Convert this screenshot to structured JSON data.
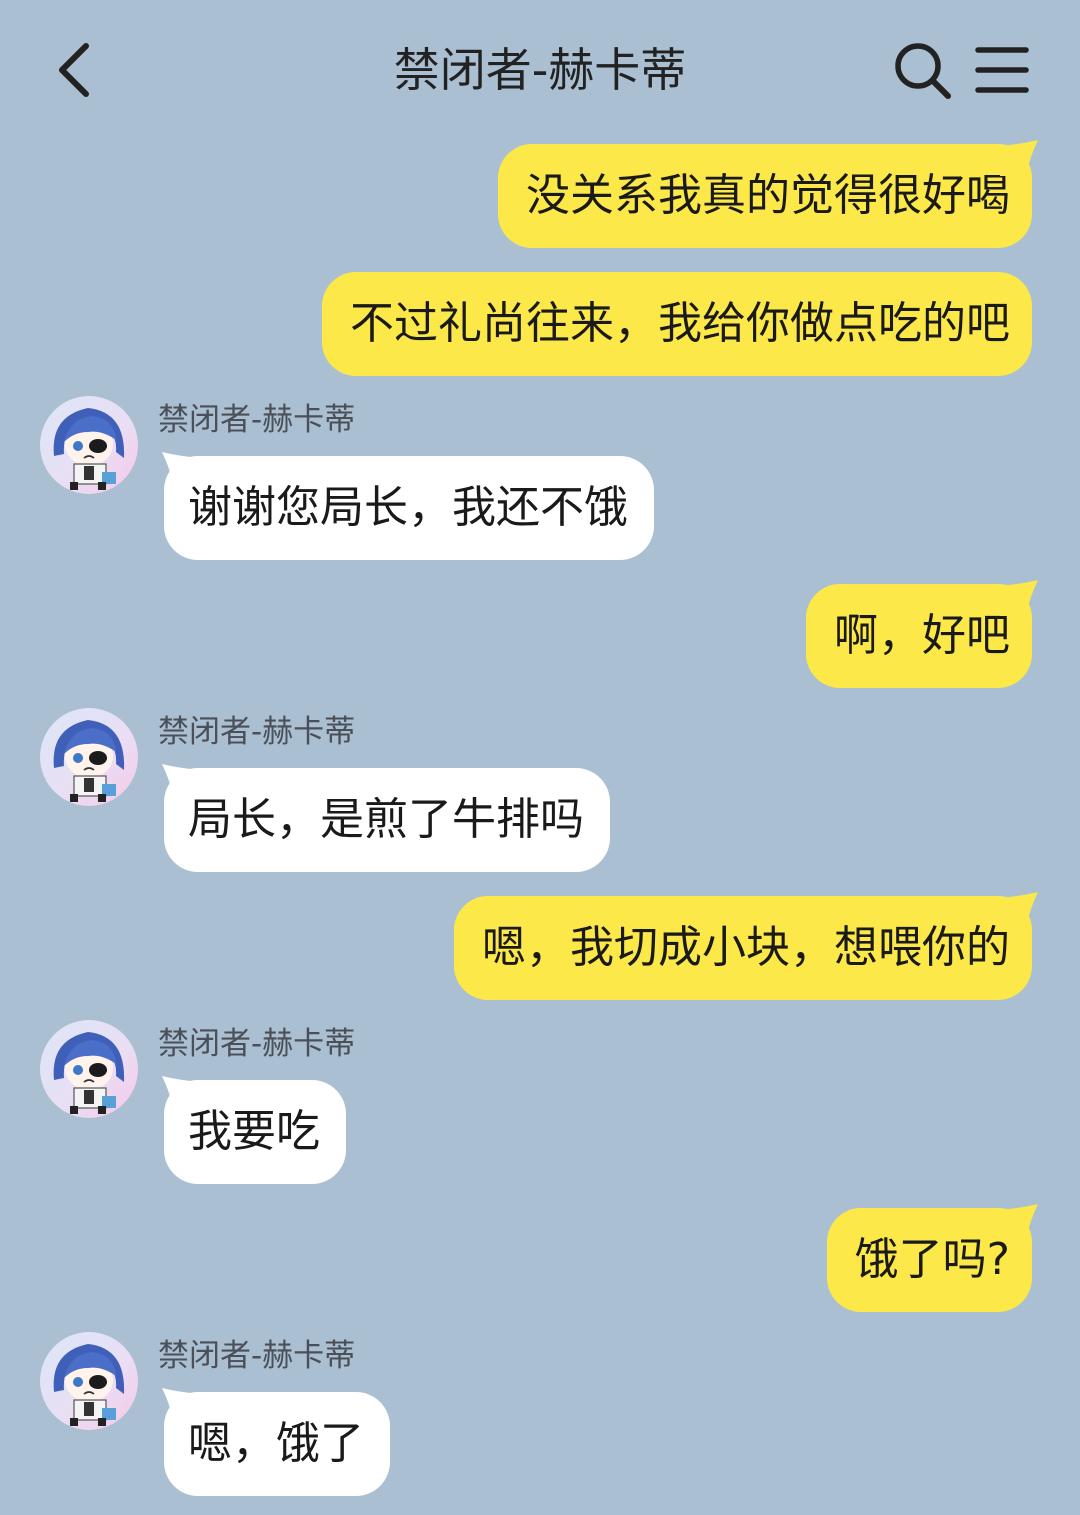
{
  "header": {
    "title": "禁闭者-赫卡蒂",
    "back_icon": "chevron-left-icon",
    "search_icon": "search-icon",
    "menu_icon": "hamburger-menu-icon"
  },
  "colors": {
    "background": "#aabfd1",
    "my_bubble": "#fde84a",
    "their_bubble": "#ffffff"
  },
  "messages": [
    {
      "from": "me",
      "text": "没关系我真的觉得很好喝"
    },
    {
      "from": "me",
      "text": "不过礼尚往来，我给你做点吃的吧"
    },
    {
      "from": "them",
      "sender": "禁闭者-赫卡蒂",
      "text": "谢谢您局长，我还不饿"
    },
    {
      "from": "me",
      "text": "啊，好吧"
    },
    {
      "from": "them",
      "sender": "禁闭者-赫卡蒂",
      "text": "局长，是煎了牛排吗"
    },
    {
      "from": "me",
      "text": "嗯，我切成小块，想喂你的"
    },
    {
      "from": "them",
      "sender": "禁闭者-赫卡蒂",
      "text": "我要吃"
    },
    {
      "from": "me",
      "text": "饿了吗?"
    },
    {
      "from": "them",
      "sender": "禁闭者-赫卡蒂",
      "text": "嗯，饿了"
    }
  ]
}
